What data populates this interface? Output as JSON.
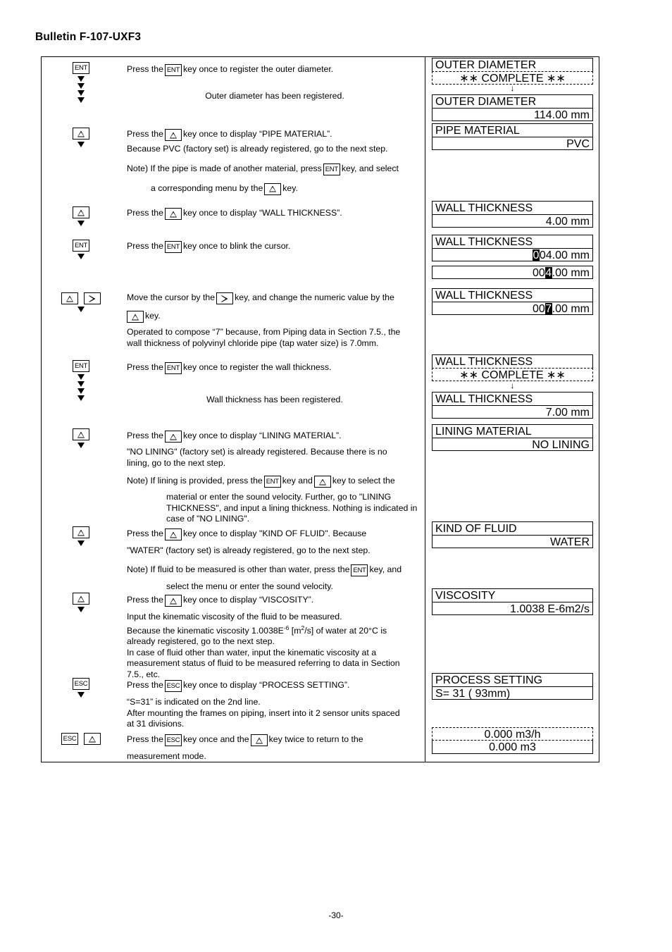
{
  "document": {
    "bulletin_title": "Bulletin F-107-UXF3",
    "page_number": "-30-"
  },
  "keys": {
    "ent": "ENT",
    "esc": "ESC",
    "up": "up-triangle",
    "right": "right-triangle",
    "down_arrow": "▼"
  },
  "steps": [
    {
      "id": "register-outer-diameter",
      "lines": [
        {
          "type": "text-with-key",
          "before": "Press the",
          "key": "ENT",
          "after": "key once to register the outer diameter."
        },
        {
          "type": "centered",
          "text": "Outer diameter has been registered."
        }
      ]
    },
    {
      "id": "display-pipe-material",
      "lines": [
        {
          "type": "text-with-key",
          "before": "Press the",
          "key": "up",
          "after": "key once to display “PIPE MATERIAL”."
        },
        {
          "type": "plain",
          "text": "Because PVC (factory set) is already registered, go to the next step."
        },
        {
          "type": "note",
          "text": "Note) If the pipe is made of another material, press",
          "key": "ENT",
          "after": "key, and select"
        },
        {
          "type": "indent-key",
          "before": "a corresponding menu by the",
          "key": "up",
          "after": "key."
        }
      ]
    },
    {
      "id": "display-wall-thickness",
      "lines": [
        {
          "type": "text-with-key",
          "before": "Press the",
          "key": "up",
          "after": "key once to display “WALL THICKNESS”."
        }
      ]
    },
    {
      "id": "blink-cursor",
      "lines": [
        {
          "type": "text-with-key",
          "before": "Press the",
          "key": "ENT",
          "after": "key once to blink the cursor."
        }
      ]
    },
    {
      "id": "move-cursor-change-value",
      "lines": [
        {
          "type": "text-with-key",
          "before": "Move the cursor by the",
          "key": "right",
          "after": "key, and change the numeric value by the"
        },
        {
          "type": "key-then-text",
          "key": "up",
          "after": "key."
        },
        {
          "type": "plain",
          "text": "Operated to compose “7” because, from Piping data in Section 7.5., the"
        },
        {
          "type": "plain",
          "text": "wall thickness of polyvinyl chloride pipe (tap water size) is 7.0mm."
        }
      ]
    },
    {
      "id": "register-wall-thickness",
      "lines": [
        {
          "type": "text-with-key",
          "before": "Press the",
          "key": "ENT",
          "after": "key once to register the wall thickness."
        },
        {
          "type": "centered",
          "text": "Wall thickness has been registered."
        }
      ]
    },
    {
      "id": "display-lining-material",
      "lines": [
        {
          "type": "text-with-key",
          "before": "Press the",
          "key": "up",
          "after": "key once to display “LINING MATERIAL”."
        },
        {
          "type": "plain",
          "text": "\"NO LINING\" (factory set) is already registered. Because there is no"
        },
        {
          "type": "plain",
          "text": "lining, go to the next step."
        },
        {
          "type": "note2",
          "before": "Note) If lining is provided, press the",
          "key1": "ENT",
          "mid": "key and",
          "key2": "up",
          "after": "key to select the"
        },
        {
          "type": "indent2",
          "text": "material or enter the sound velocity. Further, go to \"LINING"
        },
        {
          "type": "indent2",
          "text": "THICKNESS\", and input a lining thickness. Nothing is indicated in"
        },
        {
          "type": "indent2",
          "text": "case of \"NO LINING\"."
        }
      ]
    },
    {
      "id": "display-kind-of-fluid",
      "lines": [
        {
          "type": "text-with-key",
          "before": "Press the",
          "key": "up",
          "after": "key once to display \"KIND OF FLUID\".   Because"
        },
        {
          "type": "plain",
          "text": "\"WATER\" (factory set) is already registered, go to the next step."
        },
        {
          "type": "note",
          "text": "Note) If fluid to be measured is other than water, press the",
          "key": "ENT",
          "after": "key, and"
        },
        {
          "type": "indent2",
          "text": "select the menu or enter the sound velocity."
        }
      ]
    },
    {
      "id": "display-viscosity",
      "lines": [
        {
          "type": "text-with-key",
          "before": "Press the",
          "key": "up",
          "after": "key once to display “VISCOSITY”."
        },
        {
          "type": "plain",
          "text": "Input the kinematic viscosity of the fluid to be measured."
        },
        {
          "type": "plain-sup",
          "text": "Because the kinematic viscosity 1.0038E",
          "sup": "-6",
          "text2": " [m",
          "sup2": "2",
          "text3": "/s] of water at 20°C is"
        },
        {
          "type": "plain",
          "text": "already registered, go to the next step."
        },
        {
          "type": "plain",
          "text": "In case of fluid other than water, input the kinematic viscosity at a"
        },
        {
          "type": "plain",
          "text": "measurement status of fluid to be measured referring to data in Section"
        },
        {
          "type": "plain",
          "text": "7.5., etc."
        }
      ]
    },
    {
      "id": "display-process-setting",
      "lines": [
        {
          "type": "text-with-key",
          "before": "Press the",
          "key": "ESC",
          "after": "key once to display “PROCESS SETTING”."
        },
        {
          "type": "plain",
          "text": "“S=31” is indicated on the 2nd line."
        },
        {
          "type": "plain",
          "text": "After mounting the frames on piping, insert into it 2 sensor units spaced"
        },
        {
          "type": "plain",
          "text": "at 31 divisions."
        }
      ]
    },
    {
      "id": "return-to-measurement-mode",
      "lines": [
        {
          "type": "text-2keys",
          "before": "Press the",
          "key1": "ESC",
          "mid": "key once and the",
          "key2": "up",
          "after": "key twice to return to the"
        },
        {
          "type": "plain",
          "text": "measurement mode."
        }
      ]
    }
  ],
  "lcd_panels": [
    {
      "id": "outer-diameter-complete",
      "line1": "OUTER DIAMETER",
      "line2": "∗∗ COMPLETE ∗∗",
      "line2_align": "center",
      "style": "dashed"
    },
    {
      "id": "arrow-1",
      "arrow": "↓"
    },
    {
      "id": "outer-diameter-value",
      "line1": "OUTER DIAMETER",
      "line2": "114.00 mm",
      "line2_align": "right",
      "style": "solid"
    },
    {
      "id": "pipe-material",
      "line1": "PIPE MATERIAL",
      "line2": "PVC",
      "line2_align": "right",
      "style": "solid"
    },
    {
      "id": "wall-thickness-initial",
      "line1": "WALL THICKNESS",
      "line2": "4.00 mm",
      "line2_align": "right",
      "style": "solid"
    },
    {
      "id": "wall-thickness-cursor",
      "line1": "WALL THICKNESS",
      "line2_pre": "",
      "line2_cursor": "0",
      "line2_post": "04.00 mm",
      "line2_align": "right",
      "style": "solid"
    },
    {
      "id": "wall-thickness-cursor-moved",
      "line2_pre": "00",
      "line2_cursor": "4",
      "line2_post": ".00 mm",
      "line2_align": "right",
      "style": "solid-single"
    },
    {
      "id": "wall-thickness-seven",
      "line1": "WALL THICKNESS",
      "line2_pre": "00",
      "line2_cursor": "7",
      "line2_post": ".00 mm",
      "line2_align": "right",
      "style": "solid"
    },
    {
      "id": "wall-thickness-complete",
      "line1": "WALL THICKNESS",
      "line2": "∗∗ COMPLETE ∗∗",
      "line2_align": "center",
      "style": "dashed"
    },
    {
      "id": "arrow-2",
      "arrow": "↓"
    },
    {
      "id": "wall-thickness-final",
      "line1": "WALL THICKNESS",
      "line2": "7.00 mm",
      "line2_align": "right",
      "style": "solid"
    },
    {
      "id": "lining-material",
      "line1": "LINING MATERIAL",
      "line2": "NO LINING",
      "line2_align": "right",
      "style": "solid"
    },
    {
      "id": "kind-of-fluid",
      "line1": "KIND OF FLUID",
      "line2": "WATER",
      "line2_align": "right",
      "style": "solid"
    },
    {
      "id": "viscosity",
      "line1": "VISCOSITY",
      "line2": "1.0038 E-6m2/s",
      "line2_align": "right",
      "style": "solid"
    },
    {
      "id": "process-setting",
      "line1": "PROCESS SETTING",
      "line2": "S=  31  (             93mm)",
      "line2_align": "left",
      "style": "solid"
    },
    {
      "id": "measurement-mode",
      "line1": "0.000        m3/h",
      "line2": "0.000        m3",
      "line1_align": "center",
      "line2_align": "center",
      "style": "dashed"
    }
  ]
}
